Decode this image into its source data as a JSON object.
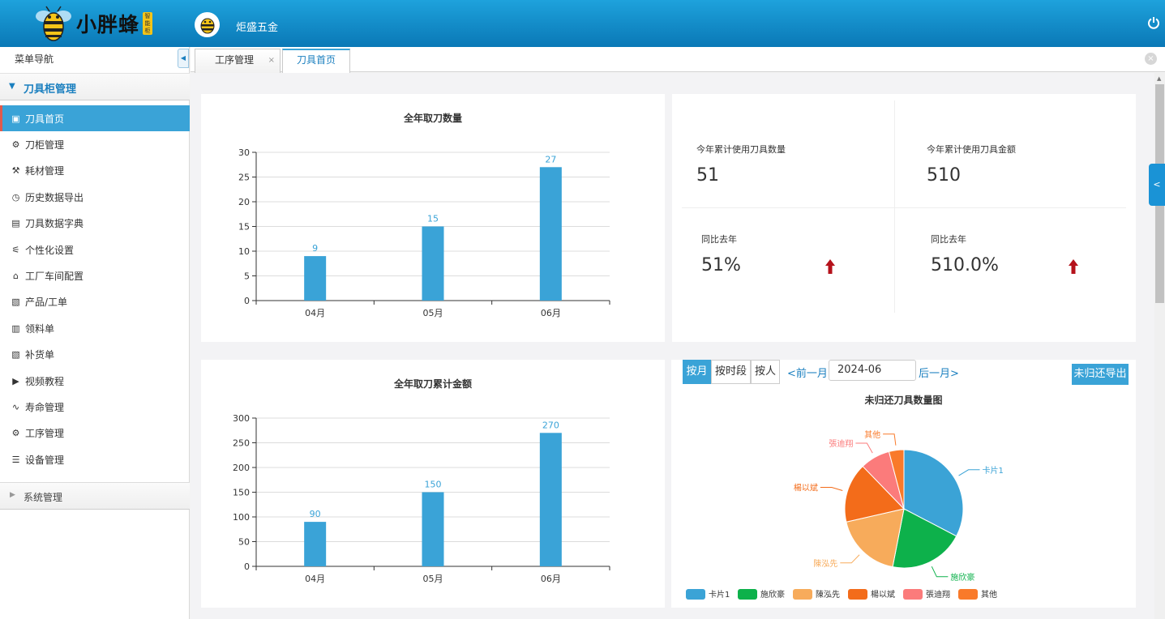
{
  "header": {
    "brand": "小胖蜂",
    "brand_tag": "智能柜",
    "company": "炬盛五金",
    "icons": {
      "logo": "bee-logo-icon",
      "power": "power-icon"
    }
  },
  "sidebar": {
    "title": "菜单导航",
    "group": "刀具柜管理",
    "items": [
      {
        "label": "刀具首页",
        "icon": "dashboard-icon",
        "active": true
      },
      {
        "label": "刀柜管理",
        "icon": "gear-icon"
      },
      {
        "label": "耗材管理",
        "icon": "tools-icon"
      },
      {
        "label": "历史数据导出",
        "icon": "history-icon"
      },
      {
        "label": "刀具数据字典",
        "icon": "book-icon"
      },
      {
        "label": "个性化设置",
        "icon": "sliders-icon"
      },
      {
        "label": "工厂车间配置",
        "icon": "home-icon"
      },
      {
        "label": "产品/工单",
        "icon": "doc-icon"
      },
      {
        "label": "领料单",
        "icon": "form-icon"
      },
      {
        "label": "补货单",
        "icon": "doc-icon"
      },
      {
        "label": "视频教程",
        "icon": "play-icon"
      },
      {
        "label": "寿命管理",
        "icon": "chart-line-icon"
      },
      {
        "label": "工序管理",
        "icon": "gear-icon"
      },
      {
        "label": "设备管理",
        "icon": "server-icon"
      }
    ],
    "system_group": "系统管理"
  },
  "tabs": [
    {
      "label": "工序管理",
      "closable": true,
      "close": "×"
    },
    {
      "label": "刀具首页",
      "active": true
    }
  ],
  "stats": {
    "qty_label": "今年累计使用刀具数量",
    "qty_value": "51",
    "amount_label": "今年累计使用刀具金额",
    "amount_value": "510",
    "yoy_label_1": "同比去年",
    "yoy_value_1": "51%",
    "yoy_label_2": "同比去年",
    "yoy_value_2": "510.0%",
    "trend_color": "#b5121b"
  },
  "controls": {
    "by_month": "按月",
    "by_period": "按时段",
    "by_person": "按人",
    "prev_month": "<前一月",
    "month_value": "2024-06",
    "next_month": "后一月>",
    "export": "未归还导出"
  },
  "colors": {
    "accent": "#3aa3d7",
    "header": "#0a78b6"
  },
  "chart_data": [
    {
      "type": "bar",
      "title": "全年取刀数量",
      "categories": [
        "04月",
        "05月",
        "06月"
      ],
      "values": [
        9,
        15,
        27
      ],
      "ylim": [
        0,
        30
      ],
      "yticks": [
        0,
        5,
        10,
        15,
        20,
        25,
        30
      ],
      "grid": true,
      "color": "#3aa3d7"
    },
    {
      "type": "bar",
      "title": "全年取刀累计金额",
      "categories": [
        "04月",
        "05月",
        "06月"
      ],
      "values": [
        90,
        150,
        270
      ],
      "ylim": [
        0,
        300
      ],
      "yticks": [
        0,
        50,
        100,
        150,
        200,
        250,
        300
      ],
      "grid": true,
      "color": "#3aa3d7"
    },
    {
      "type": "pie",
      "title": "未归还刀具数量图",
      "legend_position": "bottom",
      "slices": [
        {
          "name": "卡片1",
          "value": 32,
          "color": "#3ba3d6"
        },
        {
          "name": "施欣豪",
          "value": 20,
          "color": "#0db14b"
        },
        {
          "name": "陳泓先",
          "value": 18,
          "color": "#f7ab5b"
        },
        {
          "name": "楊以斌",
          "value": 16,
          "color": "#f36c1a"
        },
        {
          "name": "張迪翔",
          "value": 8,
          "color": "#fb7b7b"
        },
        {
          "name": "其他",
          "value": 4,
          "color": "#f97a2a"
        }
      ]
    }
  ]
}
